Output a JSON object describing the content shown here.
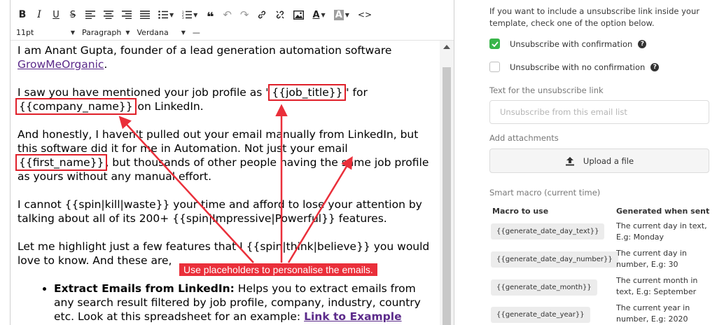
{
  "toolbar": {
    "row1": [
      {
        "icon": "bold-icon",
        "glyph": "B"
      },
      {
        "icon": "italic-icon",
        "glyph": "I"
      },
      {
        "icon": "underline-icon",
        "glyph": "U"
      },
      {
        "icon": "strikethrough-icon",
        "glyph": "S"
      },
      {
        "icon": "align-left-icon"
      },
      {
        "icon": "align-center-icon"
      },
      {
        "icon": "align-right-icon"
      },
      {
        "icon": "align-justify-icon"
      },
      {
        "icon": "bullet-list-icon"
      },
      {
        "icon": "numbered-list-icon"
      },
      {
        "icon": "blockquote-icon"
      },
      {
        "icon": "undo-icon"
      },
      {
        "icon": "redo-icon"
      },
      {
        "icon": "link-icon"
      },
      {
        "icon": "unlink-icon"
      },
      {
        "icon": "image-icon"
      },
      {
        "icon": "text-color-icon"
      },
      {
        "icon": "background-color-icon"
      },
      {
        "icon": "source-code-icon"
      }
    ],
    "font_size": "11pt",
    "block_format": "Paragraph",
    "font_family": "Verdana",
    "hr_glyph": "—"
  },
  "editor": {
    "p1": {
      "text": "I am Anant Gupta, founder of a lead generation automation software ",
      "link": "GrowMeOrganic",
      "tail": "."
    },
    "p2": {
      "a": "I saw you have mentioned your job profile as \"",
      "ph1": "{{job_title}}",
      "b": "\" for ",
      "ph2": "{{company_name}}",
      "c": " on LinkedIn."
    },
    "p3": {
      "a": "And honestly, I haven't pulled out your email manually from LinkedIn, but this software did it for me in Automation. Not just your email ",
      "ph": "{{first_name}}",
      "b": ", but thousands of other people having the same job profile as yours without any manual effort."
    },
    "p4": "I cannot {{spin|kill|waste}} your time and afford to lose your attention by talking about all of its 200+ {{spin|Impressive|Powerful}} features.",
    "p5": "Let me highlight just a few features that I {{spin|think|believe}} you would love to know. And these are,",
    "li1": {
      "bold": "Extract Emails from LinkedIn:",
      "text": " Helps you to extract emails from any search result filtered by job profile, company, industry, country etc. Look at this spreadsheet for an example: ",
      "link": "Link to Example spreadsheet"
    }
  },
  "annotation": {
    "callout": "Use placeholders to personalise the emails.",
    "color": "#ea2f3a"
  },
  "panel": {
    "intro": "If you want to include a unsubscribe link inside your template, check one of the option below.",
    "opt1": {
      "label": "Unsubscribe with confirmation",
      "checked": true
    },
    "opt2": {
      "label": "Unsubscribe with no confirmation",
      "checked": false
    },
    "unsub_label": "Text for the unsubscribe link",
    "unsub_placeholder": "Unsubscribe from this email list",
    "attach_label": "Add attachments",
    "upload_label": "Upload a file",
    "smart_macro_label": "Smart macro (current time)",
    "col_macro": "Macro to use",
    "col_generated": "Generated when sent",
    "macros": [
      {
        "macro": "{{generate_date_day_text}}",
        "desc": "The current day in text, E.g: Monday"
      },
      {
        "macro": "{{generate_date_day_number}}",
        "desc": "The current day in number, E.g: 30"
      },
      {
        "macro": "{{generate_date_month}}",
        "desc": "The current month in text, E.g: September"
      },
      {
        "macro": "{{generate_date_year}}",
        "desc": "The current year in number, E.g: 2020"
      }
    ]
  }
}
